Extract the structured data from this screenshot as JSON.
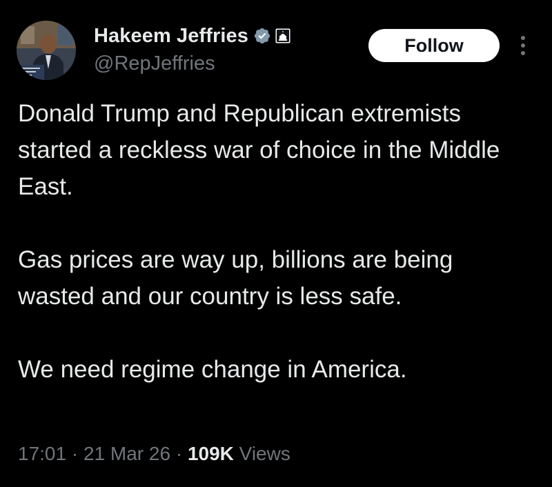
{
  "author": {
    "display_name": "Hakeem Jeffries",
    "handle": "@RepJeffries",
    "verified_icon": "verified-checkmark-icon",
    "affiliation_icon": "us-capitol-icon"
  },
  "actions": {
    "follow_label": "Follow",
    "more_icon": "vertical-ellipsis-icon"
  },
  "tweet": {
    "paragraphs": [
      "Donald Trump and Republican extremists started a reckless war of choice in the Middle East.",
      "Gas prices are way up, billions are being wasted and our country is less safe.",
      "We need regime change in America."
    ]
  },
  "meta": {
    "time": "17:01",
    "separator": "·",
    "date": "21 Mar 26",
    "views_count": "109K",
    "views_label": "Views"
  },
  "colors": {
    "background": "#000000",
    "text_primary": "#e7e9ea",
    "text_secondary": "#71767b",
    "follow_bg": "#ffffff",
    "follow_text": "#0f1419"
  }
}
